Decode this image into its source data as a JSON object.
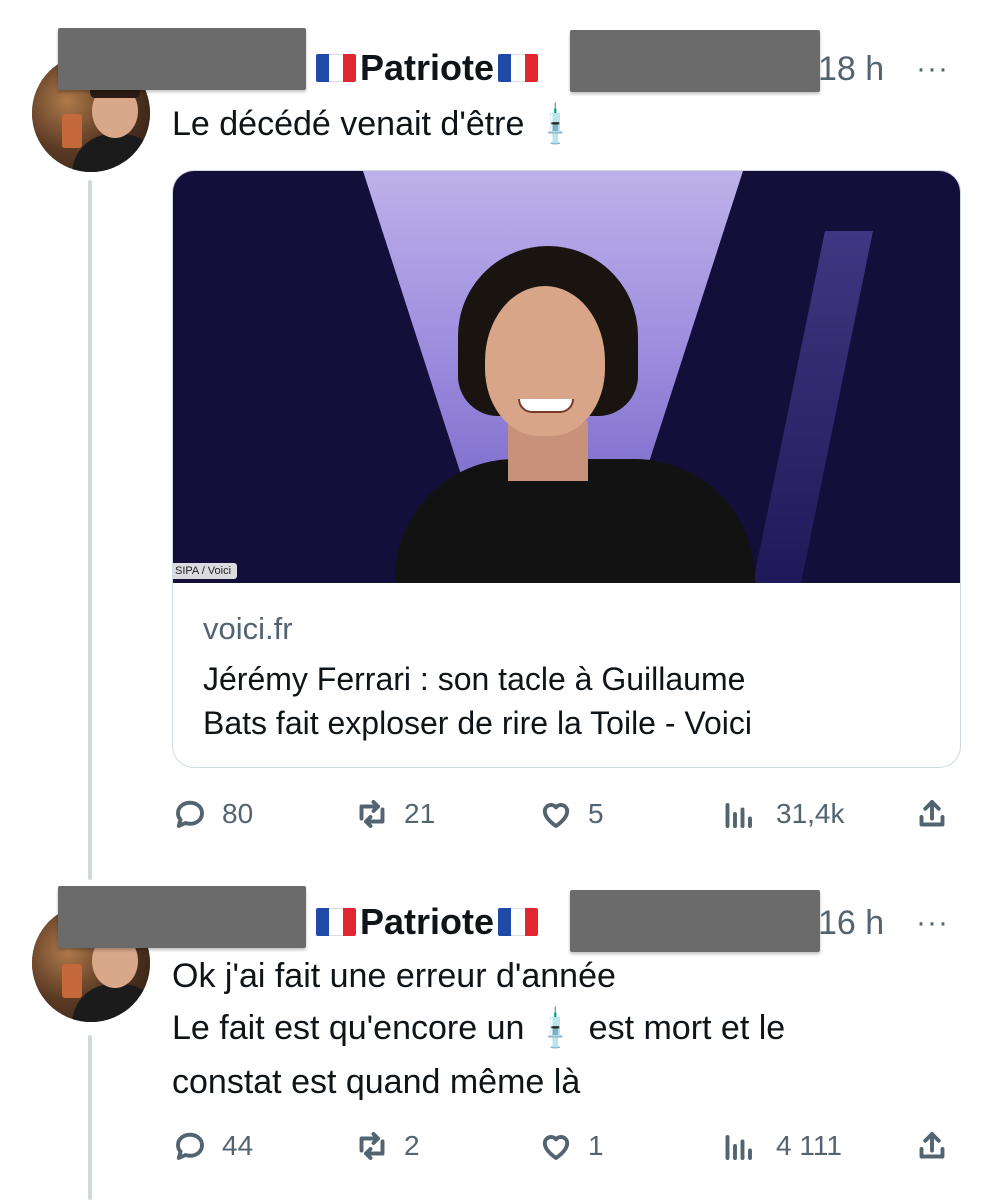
{
  "tweets": [
    {
      "author_name": "Patriote",
      "flag_left": "flag-fr",
      "flag_right": "flag-fr",
      "time": "18 h",
      "more": "···",
      "text_lines": [
        "Le décédé venait d'être"
      ],
      "card": {
        "image_credit": "SIPA / Voici",
        "domain": "voici.fr",
        "title_lines": [
          "Jérémy Ferrari : son tacle à Guillaume",
          "Bats fait exploser de rire la Toile - Voici"
        ]
      },
      "stats": {
        "replies": "80",
        "reposts": "21",
        "likes": "5",
        "views": "31,4k"
      }
    },
    {
      "author_name": "Patriote",
      "flag_left": "flag-fr",
      "flag_right": "flag-fr",
      "time": "16 h",
      "more": "···",
      "text_lines": [
        "Ok j'ai fait une erreur d'année",
        "Le fait est qu'encore un",
        "est mort et le",
        "constat est quand même là"
      ],
      "stats": {
        "replies": "44",
        "reposts": "2",
        "likes": "1",
        "views": "4 111"
      }
    }
  ],
  "icons": {
    "syringe": "syringe-emoji",
    "reply": "reply-icon",
    "repost": "repost-icon",
    "like": "heart-icon",
    "views": "views-icon",
    "share": "share-icon"
  }
}
